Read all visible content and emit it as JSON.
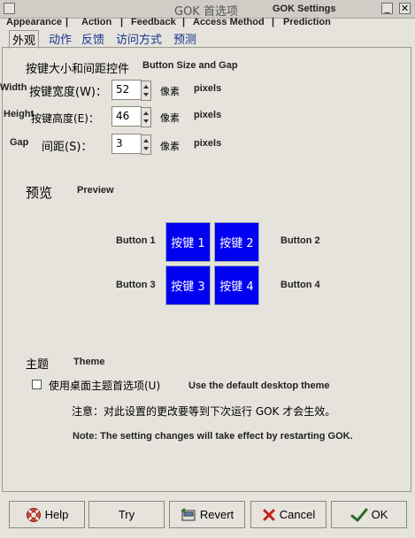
{
  "window": {
    "title": "GOK 首选项",
    "title_en": "GOK Settings"
  },
  "menu_en": [
    "Appearance",
    "Action",
    "Feedback",
    "Access Method",
    "Prediction"
  ],
  "tabs": [
    "外观",
    "动作",
    "反馈",
    "访问方式",
    "预测"
  ],
  "size_section": {
    "heading": "按键大小和间距控件",
    "heading_en": "Button Size and Gap",
    "rows": [
      {
        "en_label": "Width",
        "label": "按键宽度(W)：",
        "value": "52",
        "unit": "像素",
        "unit_en": "pixels"
      },
      {
        "en_label": "Height",
        "label": "按键高度(E)：",
        "value": "46",
        "unit": "像素",
        "unit_en": "pixels"
      },
      {
        "en_label": "Gap",
        "label": "间距(S)：",
        "value": "3",
        "unit": "像素",
        "unit_en": "pixels"
      }
    ]
  },
  "preview": {
    "heading": "预览",
    "heading_en": "Preview",
    "buttons": [
      "按键 1",
      "按键 2",
      "按键 3",
      "按键 4"
    ],
    "labels_en": [
      "Button 1",
      "Button 2",
      "Button 3",
      "Button 4"
    ],
    "button_color": "#0000f0"
  },
  "theme": {
    "heading": "主题",
    "heading_en": "Theme",
    "checkbox_label": "使用桌面主题首选项(U)",
    "checkbox_label_en": "Use the default desktop theme",
    "checked": false,
    "note": "注意：对此设置的更改要等到下次运行 GOK 才会生效。",
    "note_en": "Note: The setting changes will take effect by restarting GOK."
  },
  "buttons": {
    "help": "Help",
    "try": "Try",
    "revert": "Revert",
    "cancel": "Cancel",
    "ok": "OK"
  }
}
